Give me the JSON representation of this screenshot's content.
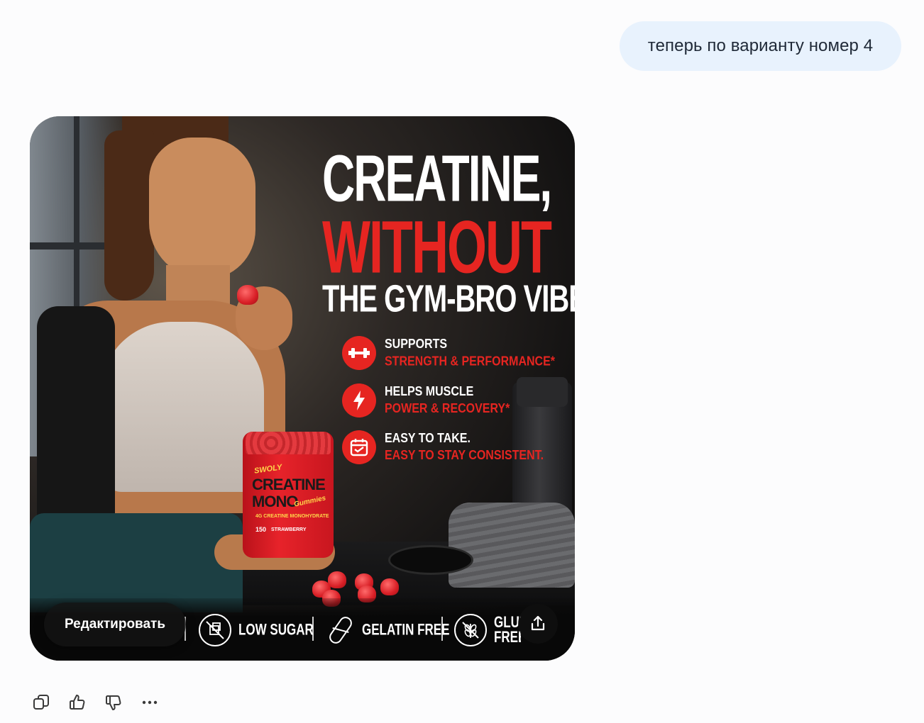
{
  "chat": {
    "user_message": "теперь по варианту номер 4"
  },
  "ad": {
    "headline_line1": "CREATINE,",
    "headline_line2": "WITHOUT",
    "headline_line3": "THE GYM-BRO VIBE",
    "accent_color": "#e62521",
    "benefits": [
      {
        "icon": "dumbbell-icon",
        "line1": "SUPPORTS",
        "line2": "STRENGTH & PERFORMANCE*"
      },
      {
        "icon": "lightning-icon",
        "line1": "HELPS MUSCLE",
        "line2": "POWER & RECOVERY*"
      },
      {
        "icon": "calendar-check-icon",
        "line1": "EASY TO TAKE.",
        "line2": "EASY TO STAY CONSISTENT."
      }
    ],
    "product": {
      "brand": "SWOLY",
      "name_line1": "CREATINE",
      "name_line2": "MONO",
      "name_script": "Gummies",
      "subtitle": "4G CREATINE MONOHYDRATE",
      "count": "150",
      "flavor": "STRAWBERRY"
    },
    "features": [
      {
        "icon": "no-sugar-icon",
        "label": "LOW SUGAR"
      },
      {
        "icon": "capsule-icon",
        "label": "GELATIN FREE"
      },
      {
        "icon": "no-gluten-icon",
        "label": "GLUT FREE"
      }
    ]
  },
  "image_actions": {
    "edit_label": "Редактировать",
    "share_icon": "share-icon"
  },
  "message_actions": [
    {
      "icon": "copy-icon"
    },
    {
      "icon": "thumbs-up-icon"
    },
    {
      "icon": "thumbs-down-icon"
    },
    {
      "icon": "more-icon"
    }
  ]
}
